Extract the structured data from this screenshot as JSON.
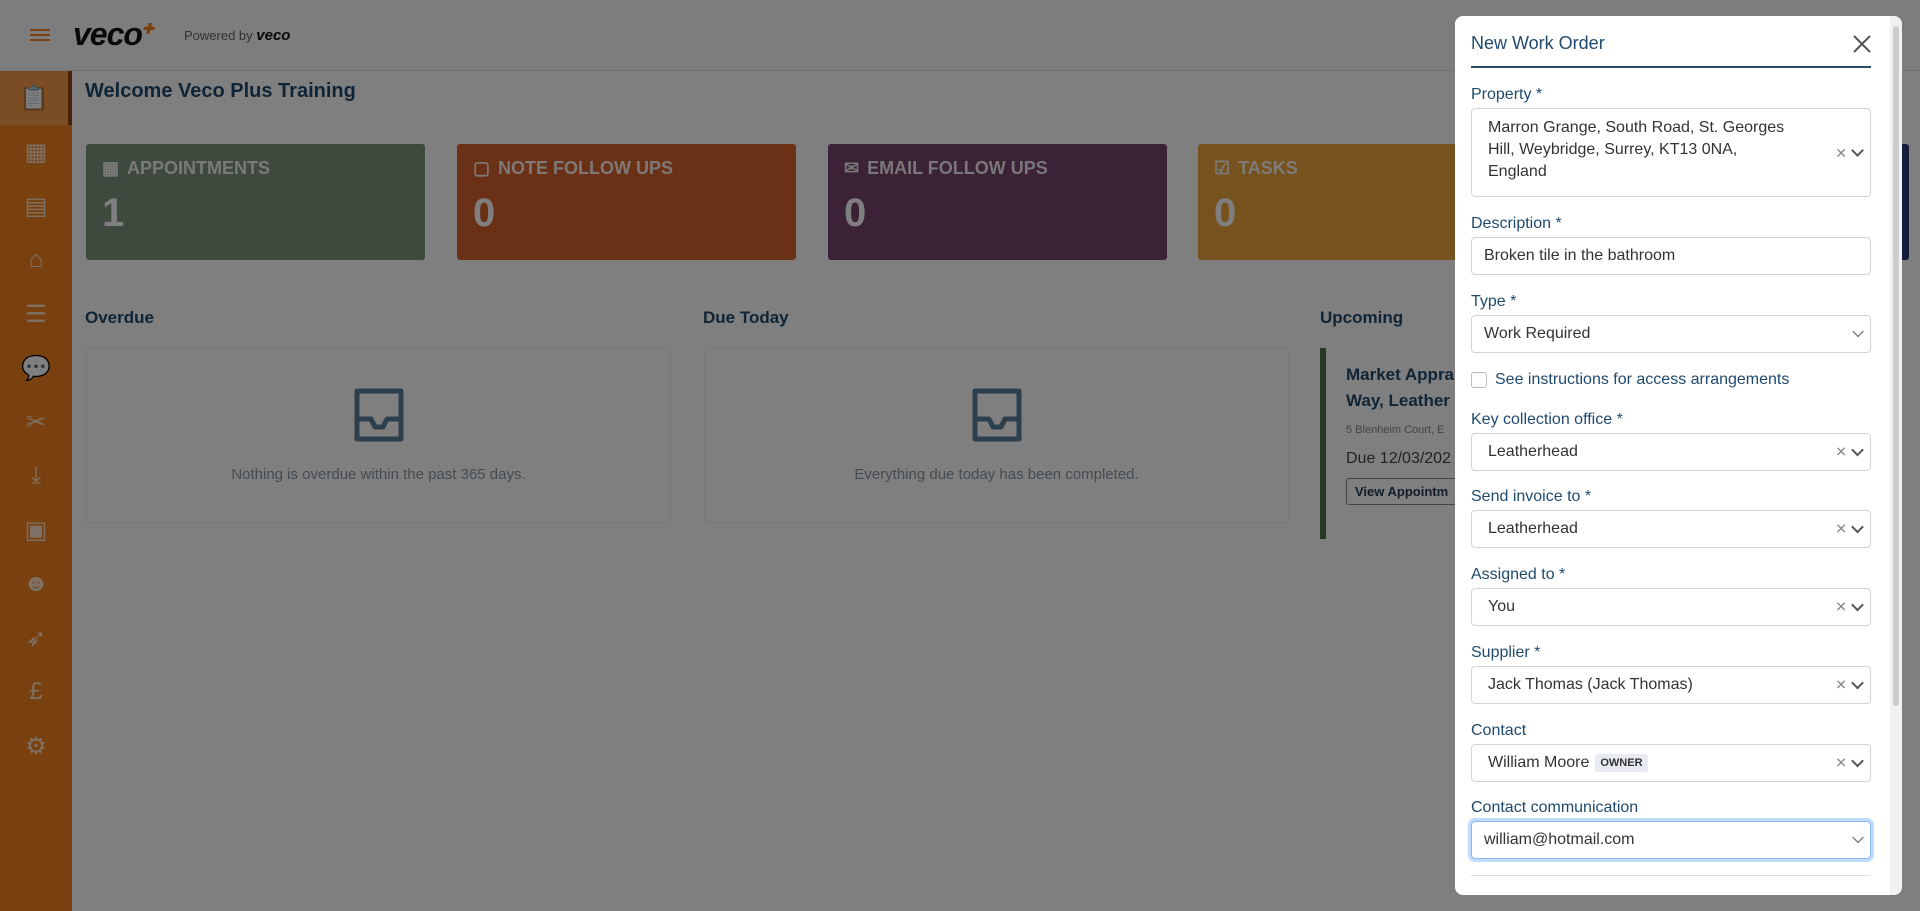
{
  "header": {
    "logo": "veco",
    "powered_by": "Powered by",
    "powered_logo": "veco"
  },
  "sidebar": {
    "items": [
      "tasks",
      "calendar",
      "buildings",
      "properties",
      "checklist",
      "messages",
      "maintenance",
      "downloads",
      "contacts",
      "contractors",
      "launch",
      "finance",
      "settings"
    ]
  },
  "welcome": "Welcome Veco Plus Training",
  "cards": [
    {
      "label": "APPOINTMENTS",
      "value": "1",
      "color": "#7d947a"
    },
    {
      "label": "NOTE FOLLOW UPS",
      "value": "0",
      "color": "#d4632e"
    },
    {
      "label": "EMAIL FOLLOW UPS",
      "value": "0",
      "color": "#77446c"
    },
    {
      "label": "TASKS",
      "value": "0",
      "color": "#eca53e"
    }
  ],
  "sections": {
    "overdue": {
      "title": "Overdue",
      "message": "Nothing is overdue within the past 365 days."
    },
    "due_today": {
      "title": "Due Today",
      "message": "Everything due today has been completed."
    },
    "upcoming": {
      "title": "Upcoming",
      "item": {
        "title_line1": "Market Appra",
        "title_line2": "Way, Leather",
        "address": "5 Blenheim Court, E",
        "due": "Due 12/03/202",
        "button": "View Appointm"
      }
    }
  },
  "modal": {
    "title": "New Work Order",
    "fields": {
      "property": {
        "label": "Property *",
        "value": "Marron Grange, South Road, St. Georges Hill, Weybridge, Surrey, KT13 0NA, England"
      },
      "description": {
        "label": "Description *",
        "value": "Broken tile in the bathroom"
      },
      "type": {
        "label": "Type *",
        "value": "Work Required"
      },
      "access": {
        "label": "See instructions for access arrangements"
      },
      "key_office": {
        "label": "Key collection office *",
        "value": "Leatherhead"
      },
      "invoice": {
        "label": "Send invoice to *",
        "value": "Leatherhead"
      },
      "assigned": {
        "label": "Assigned to *",
        "value": "You"
      },
      "supplier": {
        "label": "Supplier *",
        "value": "Jack Thomas (Jack Thomas)"
      },
      "contact": {
        "label": "Contact",
        "value": "William Moore",
        "badge": "OWNER"
      },
      "communication": {
        "label": "Contact communication",
        "value": "william@hotmail.com"
      }
    }
  }
}
